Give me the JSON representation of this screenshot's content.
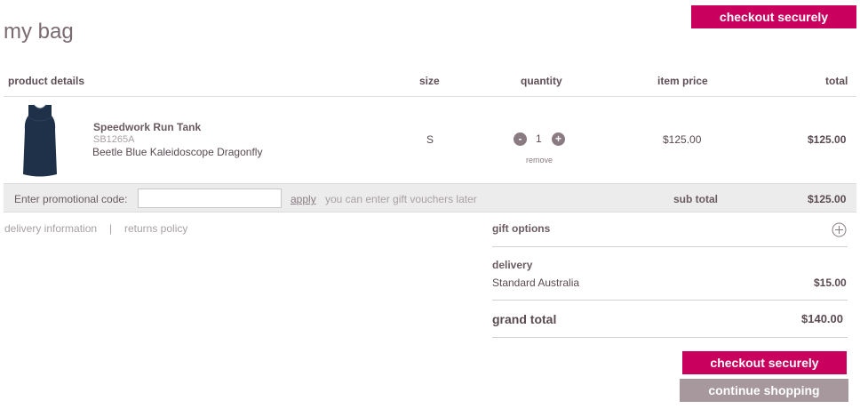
{
  "page": {
    "title": "my bag"
  },
  "buttons": {
    "checkout_top": "checkout securely",
    "checkout_bottom": "checkout securely",
    "continue": "continue shopping"
  },
  "table": {
    "headers": {
      "product": "product details",
      "size": "size",
      "quantity": "quantity",
      "item_price": "item price",
      "total": "total"
    },
    "item": {
      "name": "Speedwork Run Tank",
      "sku": "SB1265A",
      "color": "Beetle Blue Kaleidoscope Dragonfly",
      "size": "S",
      "quantity": "1",
      "item_price": "$125.00",
      "total": "$125.00",
      "remove_label": "remove",
      "minus_label": "-",
      "plus_label": "+",
      "thumbnail_icon": "tank-top-image"
    }
  },
  "promo": {
    "label": "Enter promotional code:",
    "value": "",
    "apply_label": "apply",
    "note": "you can enter gift vouchers later",
    "subtotal_label": "sub total",
    "subtotal_value": "$125.00"
  },
  "links": {
    "delivery": "delivery information",
    "separator": "|",
    "returns": "returns policy"
  },
  "summary": {
    "gift_label": "gift options",
    "gift_icon": "plus-circle-icon",
    "delivery_label": "delivery",
    "delivery_method": "Standard Australia",
    "delivery_value": "$15.00",
    "grand_label": "grand total",
    "grand_value": "$140.00"
  },
  "colors": {
    "accent": "#c9005e",
    "secondary_button": "#a7989e",
    "text": "#5a4a52"
  }
}
